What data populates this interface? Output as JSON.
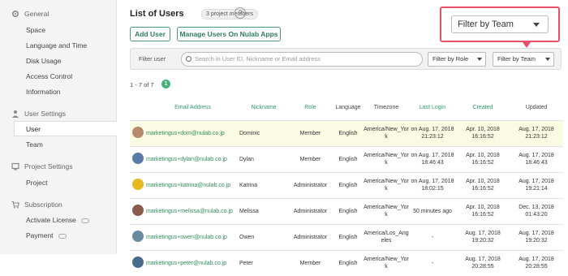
{
  "sidebar": {
    "sections": [
      {
        "title": "General",
        "icon": "gear-icon",
        "items": [
          "Space",
          "Language and Time",
          "Disk Usage",
          "Access Control",
          "Information"
        ]
      },
      {
        "title": "User Settings",
        "icon": "users-icon",
        "items": [
          "User",
          "Team"
        ]
      },
      {
        "title": "Project Settings",
        "icon": "monitor-icon",
        "items": [
          "Project"
        ]
      },
      {
        "title": "Subscription",
        "icon": "cart-icon",
        "items": [
          "Activate License",
          "Payment"
        ]
      }
    ],
    "active": "User"
  },
  "header": {
    "title": "List of Users",
    "badge": "3 project members",
    "help": "?"
  },
  "buttons": {
    "add_user": "Add User",
    "manage_apps": "Manage Users On Nulab Apps"
  },
  "callout": {
    "label": "Filter by Team",
    "accent": "#e8506a"
  },
  "filter": {
    "label": "Filter user",
    "search_placeholder": "Search in User ID, Nickname or Email address",
    "role": "Filter by Role",
    "team": "Filter by Team"
  },
  "pagination": {
    "range": "1 - 7 of 7",
    "page": "1"
  },
  "table": {
    "headers": [
      "Email Address",
      "Nickname",
      "Role",
      "Language",
      "Timezone",
      "Last Login",
      "Created",
      "Updated"
    ],
    "rows": [
      {
        "email": "marketingus+dom@nulab.co.jp",
        "nick": "Dominic",
        "role": "Member",
        "lang": "English",
        "tz": "America/New_York",
        "last": "on Aug. 17, 2018 21:23:12",
        "created": "Apr. 10, 2018 16:16:52",
        "updated": "Aug. 17, 2018 21:23:12"
      },
      {
        "email": "marketingus+dylan@nulab.co.jp",
        "nick": "Dylan",
        "role": "Member",
        "lang": "English",
        "tz": "America/New_York",
        "last": "on Aug. 17, 2018 18:46:43",
        "created": "Apr. 10, 2018 16:16:52",
        "updated": "Aug. 17, 2018 18:46:43"
      },
      {
        "email": "marketingus+katrina@nulab.co.jp",
        "nick": "Katrina",
        "role": "Administrator",
        "lang": "English",
        "tz": "America/New_York",
        "last": "on Aug. 17, 2018 18:02:15",
        "created": "Apr. 10, 2018 16:16:52",
        "updated": "Aug. 17, 2018 19:21:14"
      },
      {
        "email": "marketingus+melissa@nulab.co.jp",
        "nick": "Melissa",
        "role": "Administrator",
        "lang": "English",
        "tz": "America/New_York",
        "last": "50 minutes ago",
        "created": "Apr. 10, 2018 16:16:52",
        "updated": "Dec. 13, 2018 01:43:20"
      },
      {
        "email": "marketingus+owen@nulab.co.jp",
        "nick": "Owen",
        "role": "Administrator",
        "lang": "English",
        "tz": "America/Los_Angeles",
        "last": "-",
        "created": "Aug. 17, 2018 19:20:32",
        "updated": "Aug. 17, 2018 19:20:32"
      },
      {
        "email": "marketingus+peter@nulab.co.jp",
        "nick": "Peter",
        "role": "Member",
        "lang": "English",
        "tz": "America/New_York",
        "last": "-",
        "created": "Aug. 17, 2018 20:28:55",
        "updated": "Aug. 17, 2018 20:28:55"
      }
    ]
  }
}
